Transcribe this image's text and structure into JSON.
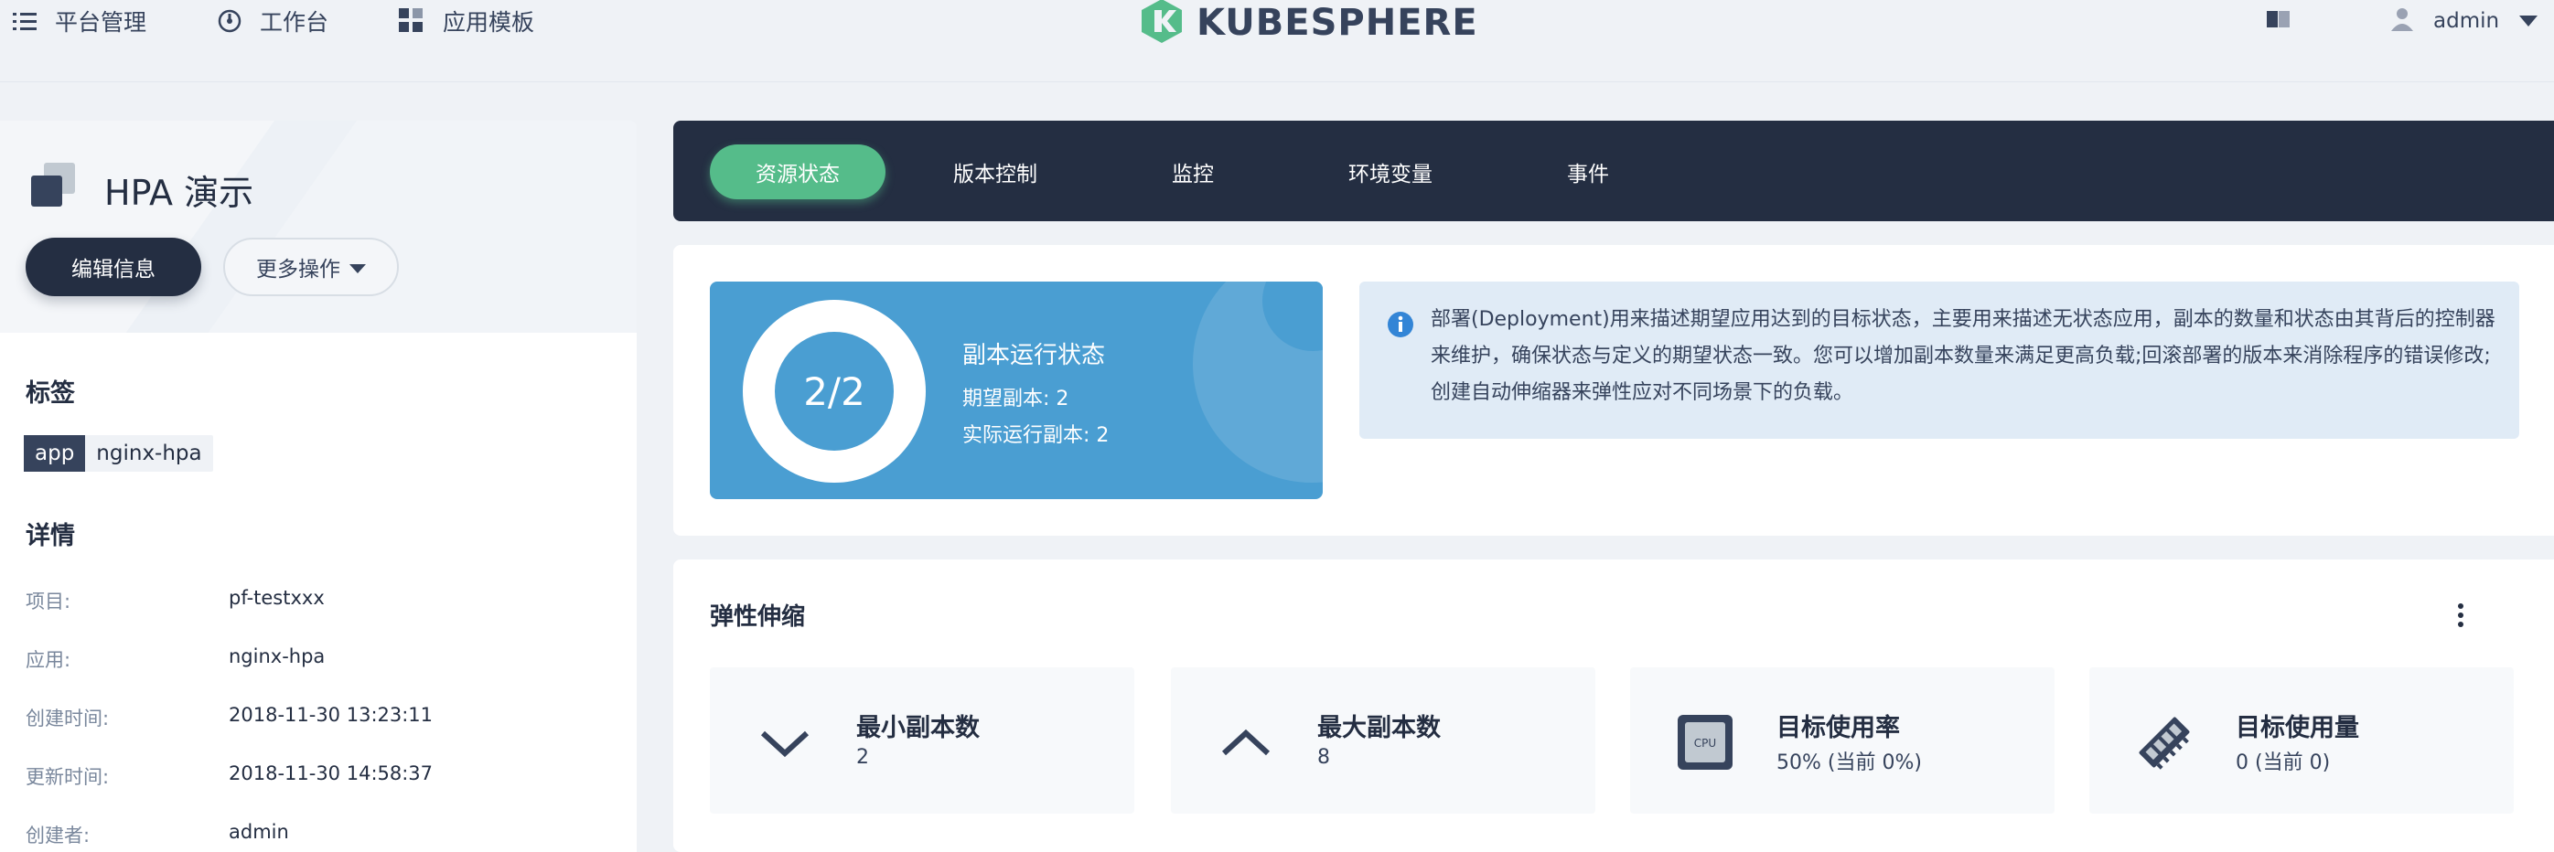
{
  "topnav": {
    "platform": "平台管理",
    "workbench": "工作台",
    "app_templates": "应用模板",
    "logo_text": "KUBESPHERE",
    "user": "admin"
  },
  "app": {
    "title": "HPA 演示",
    "edit_button": "编辑信息",
    "more_button": "更多操作"
  },
  "labels": {
    "section_title": "标签",
    "items": [
      {
        "key": "app",
        "value": "nginx-hpa"
      }
    ]
  },
  "details": {
    "section_title": "详情",
    "rows": [
      {
        "label": "项目:",
        "value": "pf-testxxx"
      },
      {
        "label": "应用:",
        "value": "nginx-hpa"
      },
      {
        "label": "创建时间:",
        "value": "2018-11-30 13:23:11"
      },
      {
        "label": "更新时间:",
        "value": "2018-11-30 14:58:37"
      },
      {
        "label": "创建者:",
        "value": "admin"
      }
    ]
  },
  "tabs": [
    {
      "label": "资源状态",
      "active": true
    },
    {
      "label": "版本控制",
      "active": false
    },
    {
      "label": "监控",
      "active": false
    },
    {
      "label": "环境变量",
      "active": false
    },
    {
      "label": "事件",
      "active": false
    }
  ],
  "replica": {
    "ratio": "2/2",
    "title": "副本运行状态",
    "desired": "期望副本: 2",
    "running": "实际运行副本: 2"
  },
  "info": {
    "text": "部署(Deployment)用来描述期望应用达到的目标状态，主要用来描述无状态应用，副本的数量和状态由其背后的控制器来维护，确保状态与定义的期望状态一致。您可以增加副本数量来满足更高负载;回滚部署的版本来消除程序的错误修改;创建自动伸缩器来弹性应对不同场景下的负载。"
  },
  "hpa": {
    "title": "弹性伸缩",
    "items": [
      {
        "label": "最小副本数",
        "value": "2",
        "icon": "chevron-down-icon"
      },
      {
        "label": "最大副本数",
        "value": "8",
        "icon": "chevron-up-icon"
      },
      {
        "label": "目标使用率",
        "value": "50% (当前 0%)",
        "icon": "cpu-icon",
        "icon_text": "CPU"
      },
      {
        "label": "目标使用量",
        "value": "0 (当前 0)",
        "icon": "memory-icon"
      }
    ]
  },
  "colors": {
    "dark": "#242e42",
    "accent_green": "#55bc8a",
    "replica_blue": "#4a9ed2",
    "info_bg": "#e0ebf6"
  }
}
